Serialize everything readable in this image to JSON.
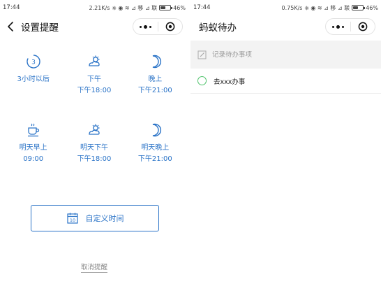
{
  "left_screen": {
    "status": {
      "time": "17:44",
      "speed": "2.21K/s",
      "signal_text": "⎈ ◉ ≋ ⊿ 移 ⊿ 联",
      "battery": "46%"
    },
    "nav": {
      "title": "设置提醒"
    },
    "options": [
      {
        "icon": "clock-3-icon",
        "l1": "3小时以后",
        "l2": ""
      },
      {
        "icon": "sun-cloud-icon",
        "l1": "下午",
        "l2": "下午18:00"
      },
      {
        "icon": "moon-icon",
        "l1": "晚上",
        "l2": "下午21:00"
      },
      {
        "icon": "coffee-cup-icon",
        "l1": "明天早上",
        "l2": "09:00"
      },
      {
        "icon": "sun-cloud-icon",
        "l1": "明天下午",
        "l2": "下午18:00"
      },
      {
        "icon": "moon-icon",
        "l1": "明天晚上",
        "l2": "下午21:00"
      }
    ],
    "clock_badge": "3",
    "custom_time": {
      "label": "自定义时间",
      "calendar_day": "10"
    },
    "cancel_label": "取消提醒"
  },
  "right_screen": {
    "status": {
      "time": "17:44",
      "speed": "0.75K/s",
      "signal_text": "⎈ ◉ ≋ ⊿ 移 ⊿ 联",
      "battery": "46%"
    },
    "nav": {
      "title": "蚂蚁待办"
    },
    "input": {
      "placeholder": "记录待办事项",
      "value": ""
    },
    "todos": [
      {
        "text": "去xxx办事"
      }
    ]
  },
  "colors": {
    "accent": "#2a73c7",
    "check_green": "#4fc36b",
    "input_bg": "#f3f3f3"
  }
}
